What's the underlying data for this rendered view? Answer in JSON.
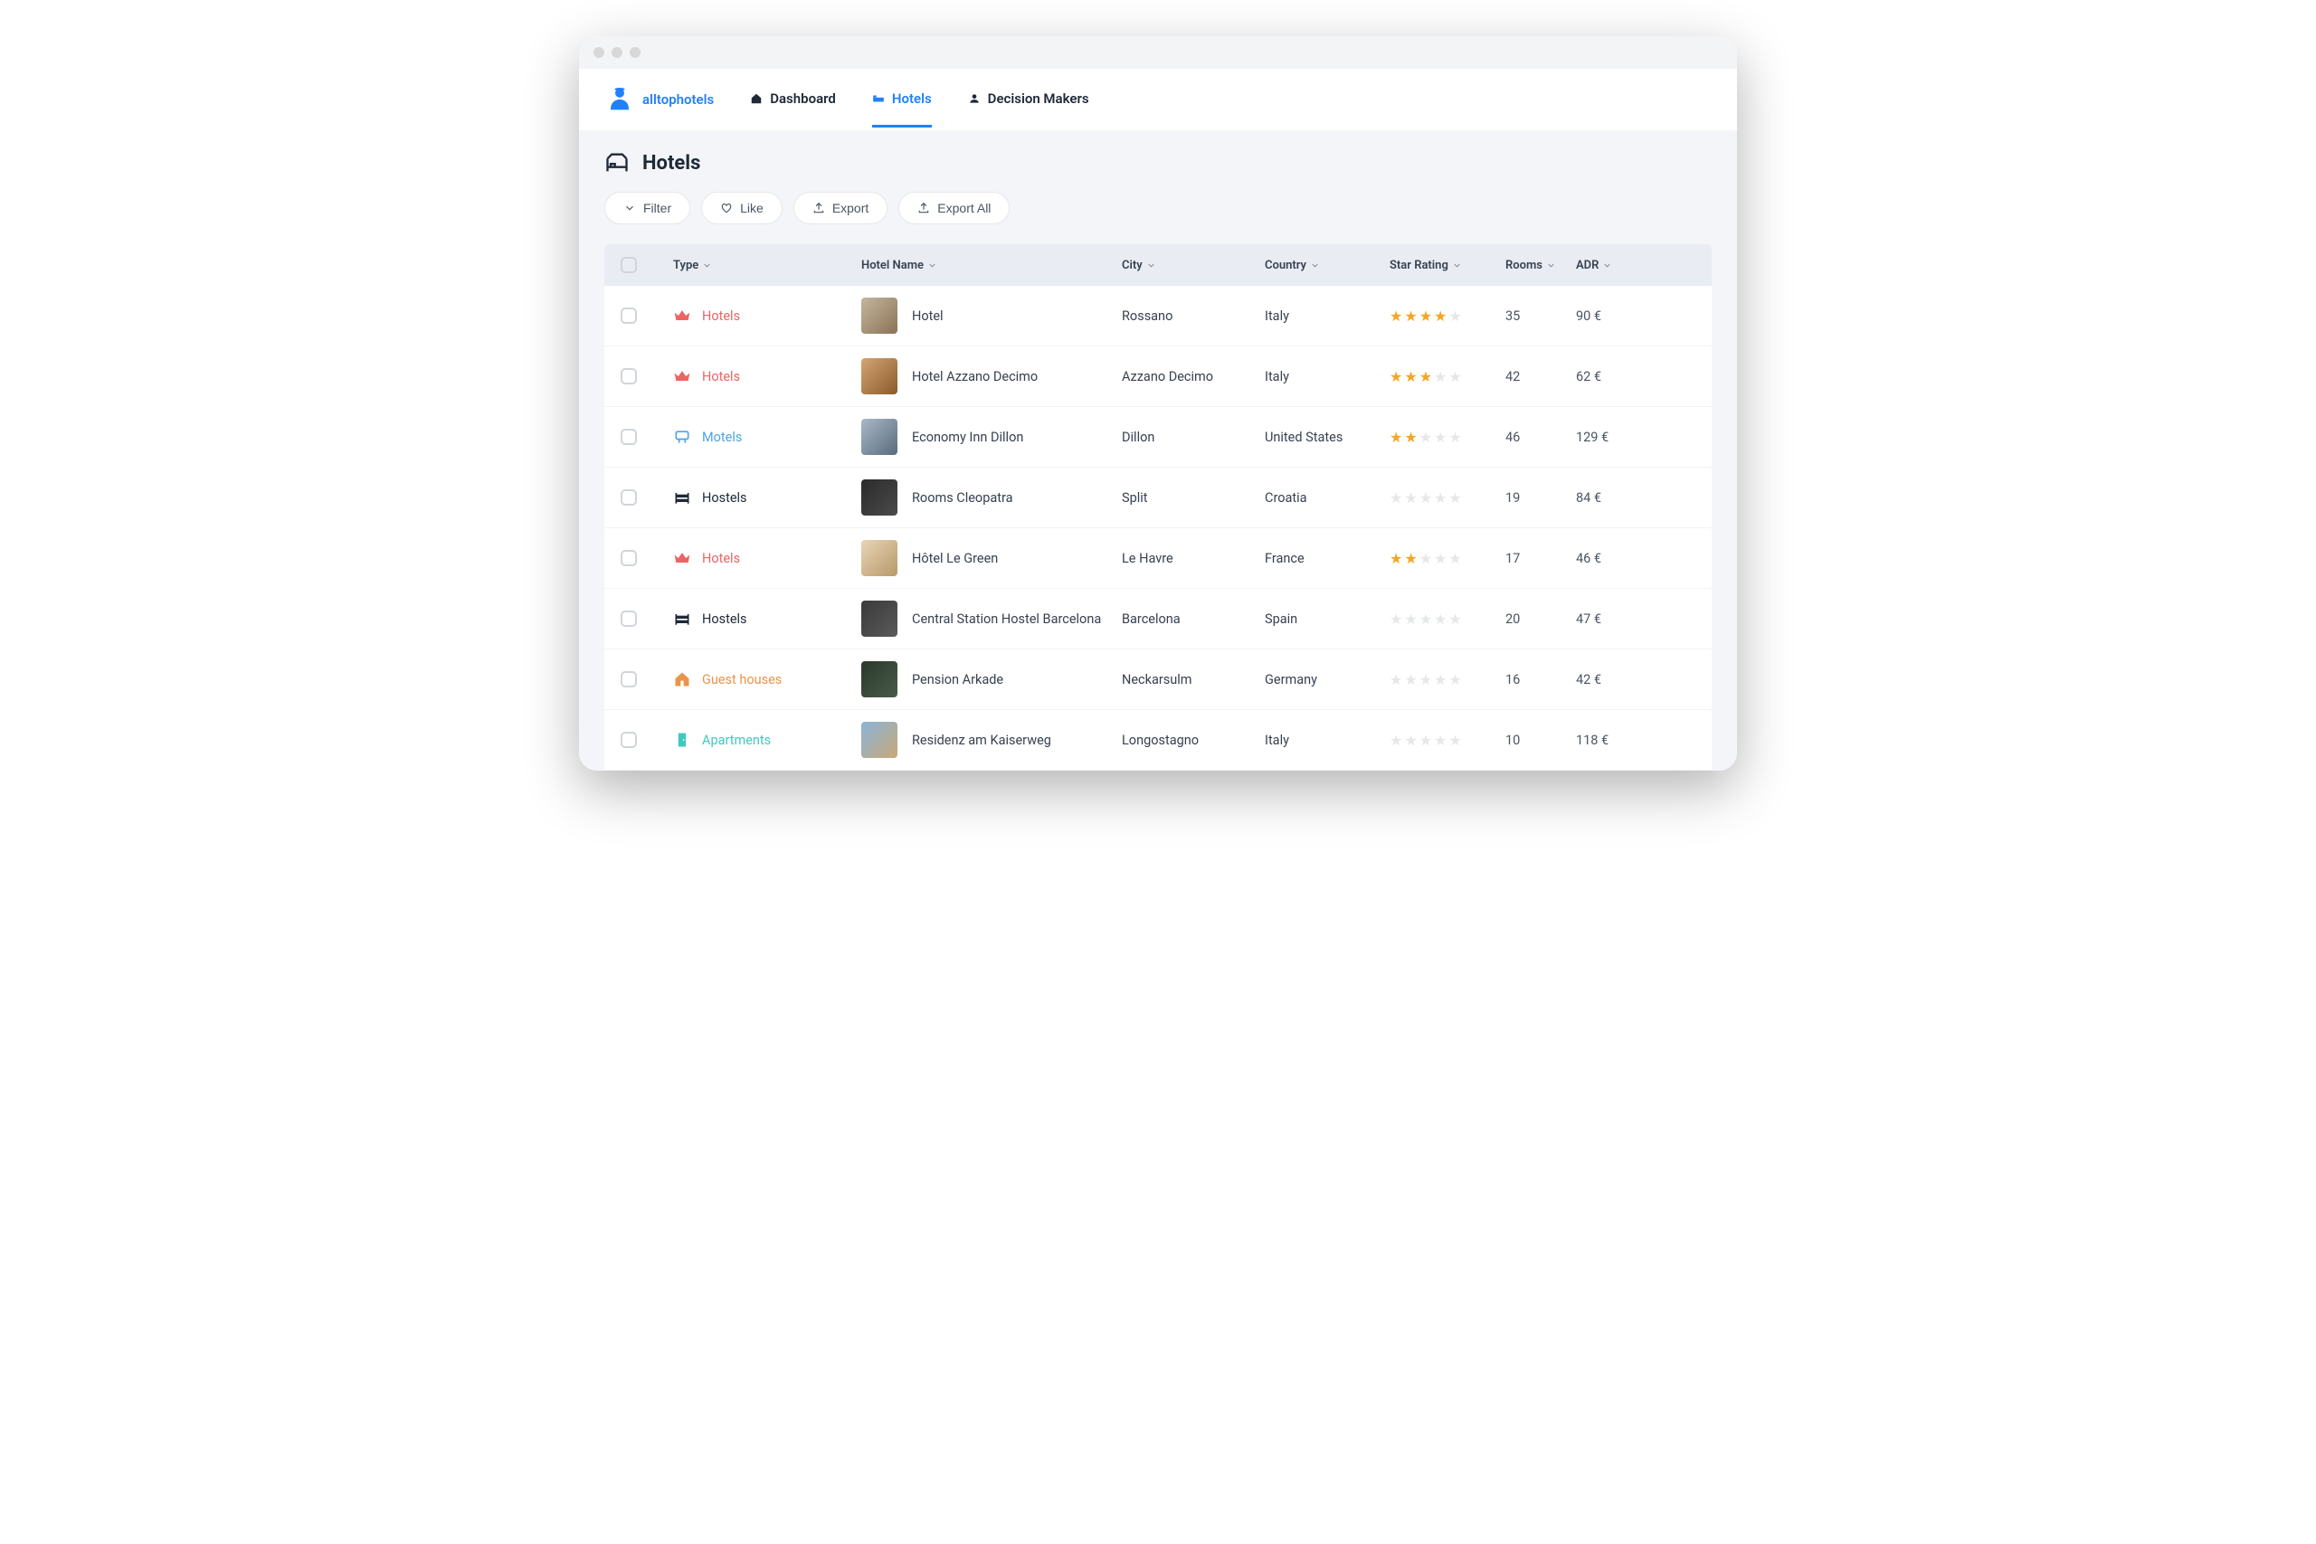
{
  "brand": {
    "prefix": "all",
    "mid": "top",
    "suffix": "hotels"
  },
  "nav": {
    "dashboard": "Dashboard",
    "hotels": "Hotels",
    "decision_makers": "Decision Makers"
  },
  "page": {
    "title": "Hotels"
  },
  "toolbar": {
    "filter": "Filter",
    "like": "Like",
    "export": "Export",
    "export_all": "Export All"
  },
  "columns": {
    "type": "Type",
    "hotel_name": "Hotel Name",
    "city": "City",
    "country": "Country",
    "star_rating": "Star Rating",
    "rooms": "Rooms",
    "adr": "ADR"
  },
  "rows": [
    {
      "type": "Hotels",
      "type_class": "hotels",
      "name": "Hotel",
      "city": "Rossano",
      "country": "Italy",
      "stars": 4,
      "rooms": "35",
      "adr": "90 €"
    },
    {
      "type": "Hotels",
      "type_class": "hotels",
      "name": "Hotel Azzano Decimo",
      "city": "Azzano Decimo",
      "country": "Italy",
      "stars": 3,
      "rooms": "42",
      "adr": "62 €"
    },
    {
      "type": "Motels",
      "type_class": "motels",
      "name": "Economy Inn Dillon",
      "city": "Dillon",
      "country": "United States",
      "stars": 2,
      "rooms": "46",
      "adr": "129 €"
    },
    {
      "type": "Hostels",
      "type_class": "hostels",
      "name": "Rooms Cleopatra",
      "city": "Split",
      "country": "Croatia",
      "stars": 0,
      "rooms": "19",
      "adr": "84 €"
    },
    {
      "type": "Hotels",
      "type_class": "hotels",
      "name": "Hôtel Le Green",
      "city": "Le Havre",
      "country": "France",
      "stars": 2,
      "rooms": "17",
      "adr": "46 €"
    },
    {
      "type": "Hostels",
      "type_class": "hostels",
      "name": "Central Station Hostel Barcelona",
      "city": "Barcelona",
      "country": "Spain",
      "stars": 0,
      "rooms": "20",
      "adr": "47 €"
    },
    {
      "type": "Guest houses",
      "type_class": "guest",
      "name": "Pension Arkade",
      "city": "Neckarsulm",
      "country": "Germany",
      "stars": 0,
      "rooms": "16",
      "adr": "42 €"
    },
    {
      "type": "Apartments",
      "type_class": "apartments",
      "name": "Residenz am Kaiserweg",
      "city": "Longostagno",
      "country": "Italy",
      "stars": 0,
      "rooms": "10",
      "adr": "118 €"
    }
  ]
}
